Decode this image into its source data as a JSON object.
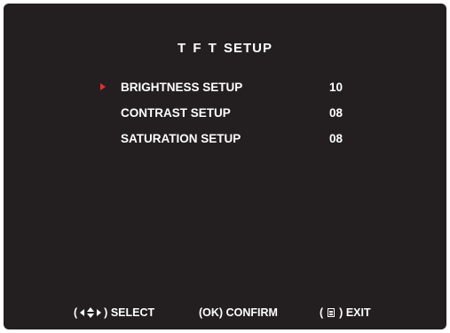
{
  "title": "T F T  SETUP",
  "menu": [
    {
      "label": "BRIGHTNESS SETUP",
      "value": "10",
      "selected": true
    },
    {
      "label": "CONTRAST SETUP",
      "value": "08",
      "selected": false
    },
    {
      "label": "SATURATION SETUP",
      "value": "08",
      "selected": false
    }
  ],
  "footer": {
    "select_label": "SELECT",
    "confirm_key": "OK",
    "confirm_label": "CONFIRM",
    "exit_label": "EXIT"
  },
  "icons": {
    "selection_marker": "red-triangle-pointer-icon",
    "navigate": "arrows-navigate-icon",
    "menu": "menu-key-icon"
  },
  "colors": {
    "background": "#231f20",
    "text": "#ffffff",
    "accent": "#e03131"
  }
}
